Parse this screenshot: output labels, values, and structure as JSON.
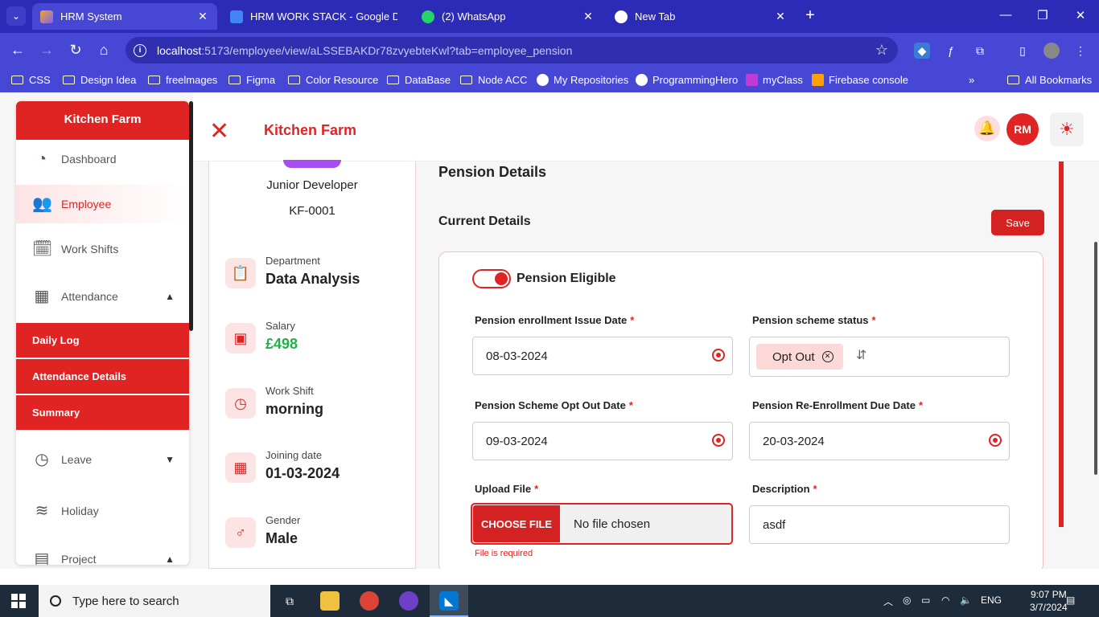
{
  "browser": {
    "tabs": [
      {
        "title": "HRM System",
        "active": true
      },
      {
        "title": "HRM WORK STACK - Google Do",
        "active": false
      },
      {
        "title": "(2) WhatsApp",
        "active": false
      },
      {
        "title": "New Tab",
        "active": false
      }
    ],
    "url_host": "localhost",
    "url_path": ":5173/employee/view/aLSSEBAKDr78zvyebteKwl?tab=employee_pension",
    "bookmarks": [
      "CSS",
      "Design Idea",
      "freelmages",
      "Figma",
      "Color Resource",
      "DataBase",
      "Node ACC",
      "My Repositories",
      "ProgrammingHero",
      "myClass",
      "Firebase console"
    ],
    "all_bookmarks": "All Bookmarks"
  },
  "sidebar": {
    "brand": "Kitchen Farm",
    "items": [
      {
        "label": "Dashboard",
        "icon": "pie-chart-icon"
      },
      {
        "label": "Employee",
        "icon": "users-icon"
      },
      {
        "label": "Work Shifts",
        "icon": "calendar-clock-icon"
      },
      {
        "label": "Attendance",
        "icon": "calendar-icon"
      },
      {
        "label": "Leave",
        "icon": "clock-icon"
      },
      {
        "label": "Holiday",
        "icon": "swimmer-icon"
      },
      {
        "label": "Project",
        "icon": "document-icon"
      }
    ],
    "attendance_sub": [
      "Daily Log",
      "Attendance Details",
      "Summary"
    ]
  },
  "topbar": {
    "title": "Kitchen Farm",
    "avatar_initials": "RM"
  },
  "profile": {
    "role": "Junior Developer",
    "employee_id": "KF-0001",
    "department_label": "Department",
    "department": "Data Analysis",
    "salary_label": "Salary",
    "salary": "£498",
    "work_shift_label": "Work Shift",
    "work_shift": "morning",
    "joining_label": "Joining date",
    "joining_date": "01-03-2024",
    "gender_label": "Gender",
    "gender": "Male"
  },
  "pension": {
    "heading": "Pension Details",
    "current_heading": "Current Details",
    "save_label": "Save",
    "eligible_label": "Pension Eligible",
    "enrollment_label": "Pension enrollment Issue Date",
    "enrollment_value": "08-03-2024",
    "status_label": "Pension scheme status",
    "status_value": "Opt Out",
    "optout_label": "Pension Scheme Opt Out Date",
    "optout_value": "09-03-2024",
    "reenroll_label": "Pension Re-Enrollment Due Date",
    "reenroll_value": "20-03-2024",
    "upload_label": "Upload File",
    "choose_file": "CHOOSE FILE",
    "no_file": "No file chosen",
    "file_error": "File is required",
    "description_label": "Description",
    "description_value": "asdf",
    "required_mark": "*"
  },
  "taskbar": {
    "search_placeholder": "Type here to search",
    "lang": "ENG",
    "time": "9:07 PM",
    "date": "3/7/2024"
  }
}
